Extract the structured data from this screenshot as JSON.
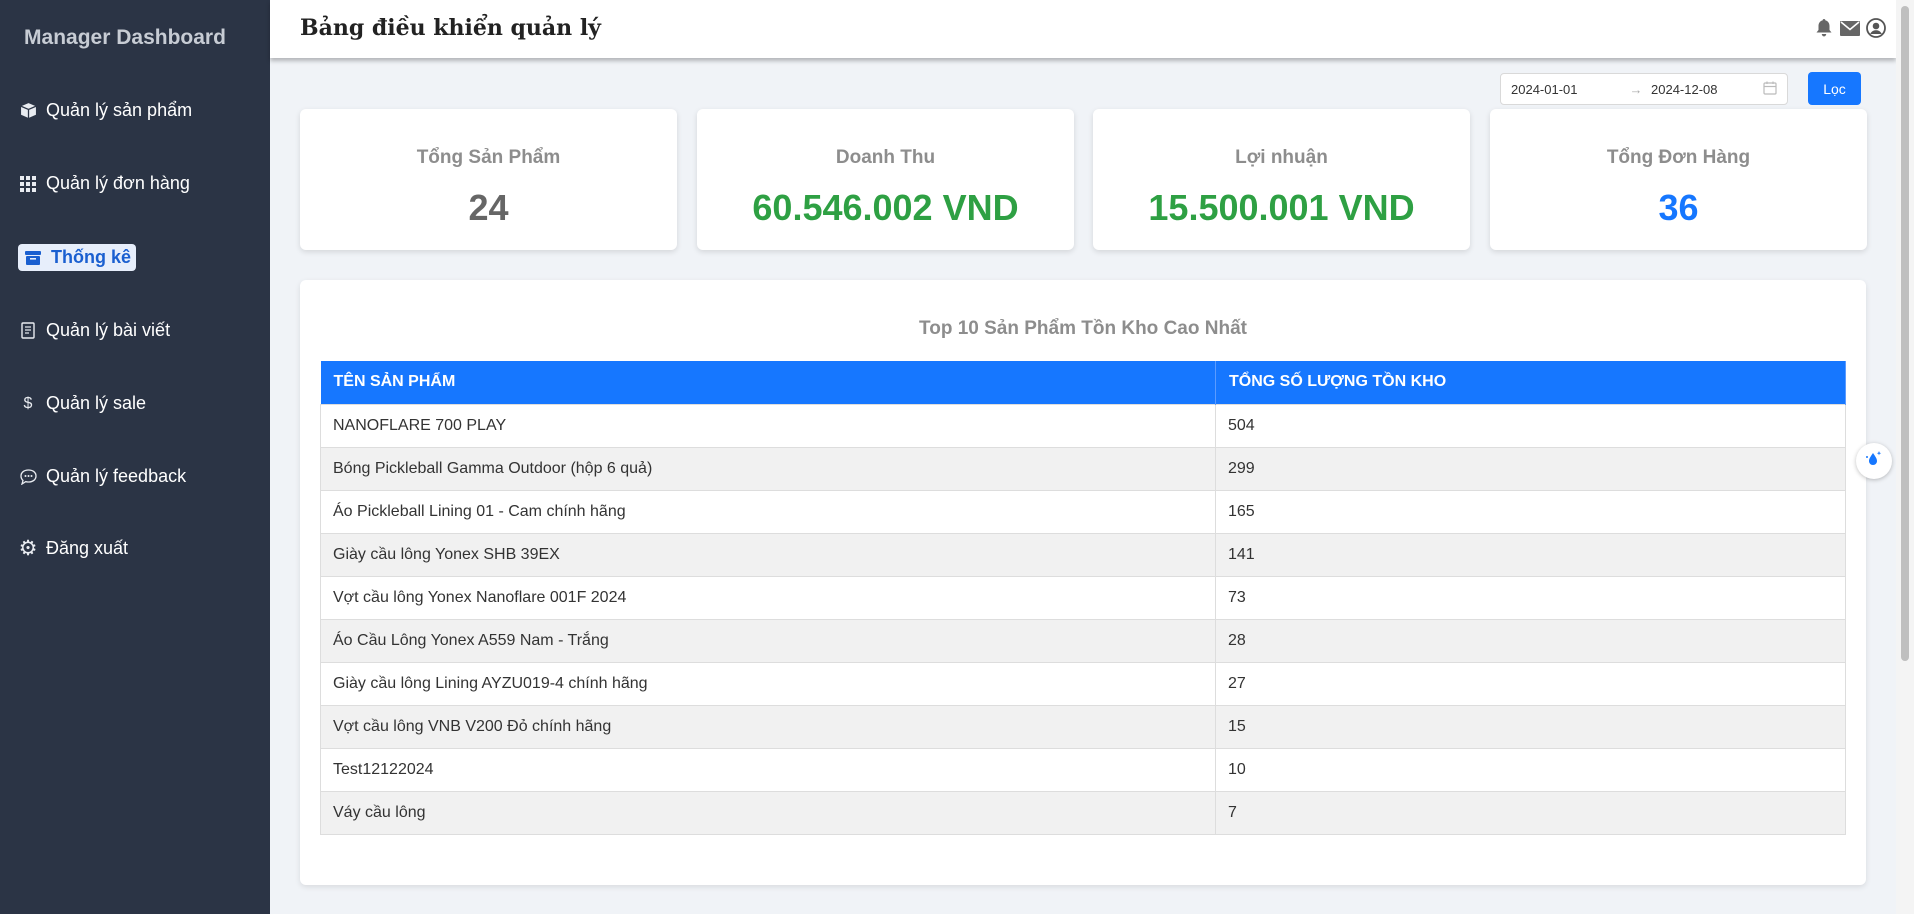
{
  "sidebar": {
    "brand": "Manager Dashboard",
    "items": [
      {
        "label": "Quản lý sản phẩm",
        "icon": "box-icon"
      },
      {
        "label": "Quản lý đơn hàng",
        "icon": "grid-icon"
      },
      {
        "label": "Thống kê",
        "icon": "archive-icon",
        "active": true
      },
      {
        "label": "Quản lý bài viết",
        "icon": "document-icon"
      },
      {
        "label": "Quản lý sale",
        "icon": "dollar-icon"
      },
      {
        "label": "Quản lý feedback",
        "icon": "chat-icon"
      },
      {
        "label": "Đăng xuất",
        "icon": "gear-icon"
      }
    ]
  },
  "header": {
    "title": "Bảng điều khiển quản lý",
    "icons": [
      "bell-icon",
      "mail-icon",
      "user-icon"
    ]
  },
  "filter": {
    "start_date": "2024-01-01",
    "end_date": "2024-12-08",
    "button_label": "Lọc"
  },
  "stats": [
    {
      "label": "Tổng Sản Phẩm",
      "value": "24",
      "color": "#666666"
    },
    {
      "label": "Doanh Thu",
      "value": "60.546.002 VND",
      "color": "#2ea043"
    },
    {
      "label": "Lợi nhuận",
      "value": "15.500.001 VND",
      "color": "#2ea043"
    },
    {
      "label": "Tổng Đơn Hàng",
      "value": "36",
      "color": "#1677ff"
    }
  ],
  "table": {
    "title": "Top 10 Sản Phẩm Tồn Kho Cao Nhất",
    "headers": [
      "TÊN SẢN PHẨM",
      "TỔNG SỐ LƯỢNG TỒN KHO"
    ],
    "rows": [
      [
        "NANOFLARE 700 PLAY",
        "504"
      ],
      [
        "Bóng Pickleball Gamma Outdoor (hộp 6 quả)",
        "299"
      ],
      [
        "Áo Pickleball Lining 01 - Cam chính hãng",
        "165"
      ],
      [
        "Giày cầu lông Yonex SHB 39EX",
        "141"
      ],
      [
        "Vợt cầu lông Yonex Nanoflare 001F 2024",
        "73"
      ],
      [
        "Áo Cầu Lông Yonex A559 Nam - Trắng",
        "28"
      ],
      [
        "Giày cầu lông Lining AYZU019-4 chính hãng",
        "27"
      ],
      [
        "Vợt cầu lông VNB V200 Đỏ chính hãng",
        "15"
      ],
      [
        "Test12122024",
        "10"
      ],
      [
        "Váy cầu lông",
        "7"
      ]
    ]
  },
  "colors": {
    "sidebar_bg": "#2b3445",
    "accent": "#1677ff",
    "success": "#2ea043"
  }
}
